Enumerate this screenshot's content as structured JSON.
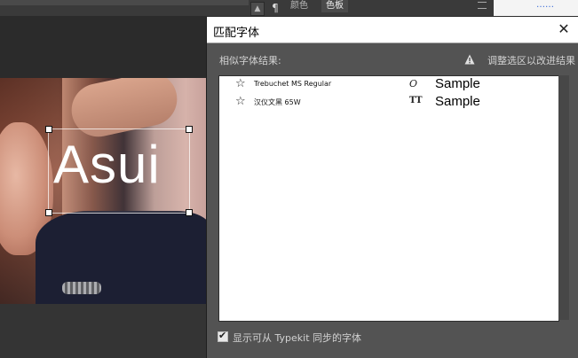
{
  "workspace": {
    "panel_tabs": [
      "颜色",
      "色板"
    ],
    "right_snippet": "……",
    "canvas_text": "Asui"
  },
  "dialog": {
    "title": "匹配字体",
    "close_glyph": "✕",
    "results_label": "相似字体结果:",
    "improve_link": "调整选区以改进结果",
    "fonts": [
      {
        "name": "Trebuchet MS Regular",
        "type_icon": "opentype-icon",
        "type_glyph": "O",
        "sample": "Sample",
        "favorite": false
      },
      {
        "name": "汉仪文黑 65W",
        "type_icon": "truetype-icon",
        "type_glyph": "TT",
        "sample": "Sample",
        "favorite": false
      }
    ],
    "sync_checkbox": {
      "label": "显示可从 Typekit 同步的字体",
      "checked": true
    }
  },
  "colors": {
    "dialog_bg": "#535353",
    "list_bg": "#ffffff",
    "accent_link": "#3b6bd6"
  }
}
